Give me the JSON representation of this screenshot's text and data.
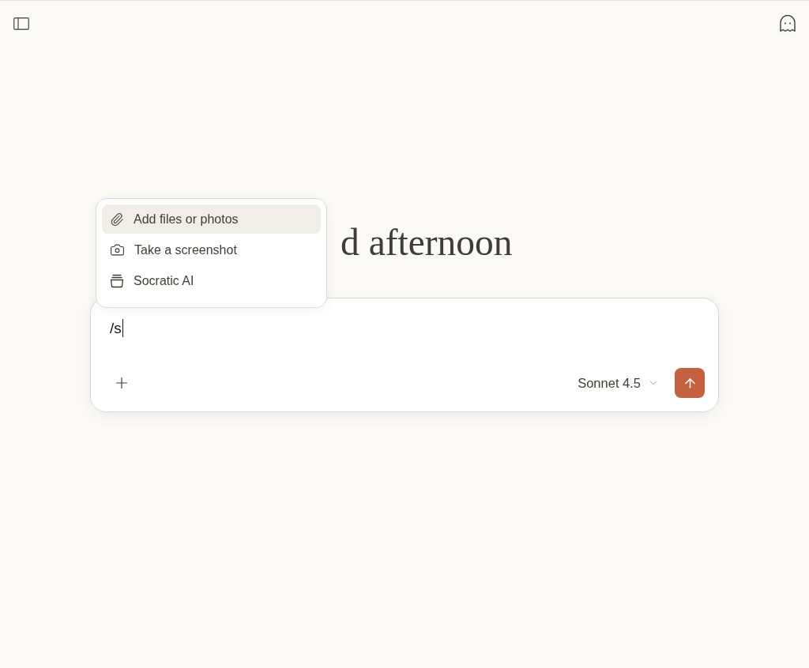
{
  "greeting": "d afternoon",
  "attach_menu": {
    "items": [
      {
        "kind": "attach",
        "label": "Add files or photos",
        "selected": true
      },
      {
        "kind": "screenshot",
        "label": "Take a screenshot",
        "selected": false
      },
      {
        "kind": "project",
        "label": "Socratic AI",
        "selected": false
      }
    ]
  },
  "composer": {
    "value": "/s",
    "model": "Sonnet 4.5"
  }
}
